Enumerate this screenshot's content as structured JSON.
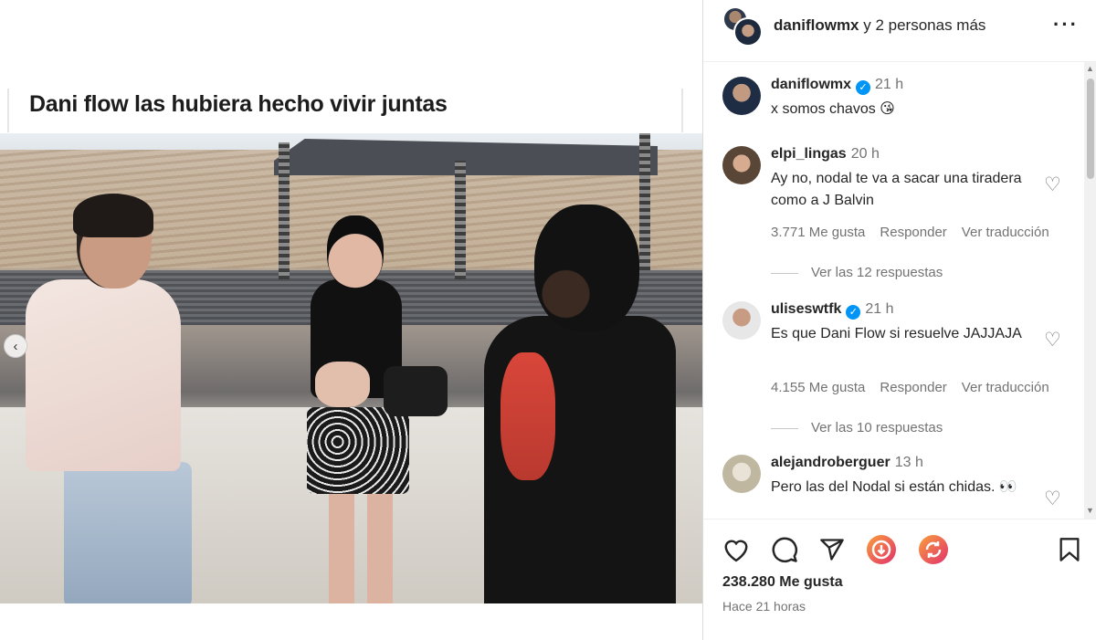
{
  "post": {
    "caption_overlay": "Dani flow las hubiera hecho vivir juntas"
  },
  "header": {
    "owner": "daniflowmx",
    "owner_more": "y 2 personas más"
  },
  "comments": [
    {
      "username": "daniflowmx",
      "verified": true,
      "time": "21 h",
      "text": "x somos chavos 😘"
    },
    {
      "username": "elpi_lingas",
      "verified": false,
      "time": "20 h",
      "text": "Ay no, nodal te va a sacar una tiradera como a J Balvin",
      "likes": "3.771 Me gusta",
      "reply": "Responder",
      "translate": "Ver traducción",
      "view_replies": "Ver las 12 respuestas"
    },
    {
      "username": "uliseswtfk",
      "verified": true,
      "time": "21 h",
      "text": "Es que Dani Flow si resuelve JAJJAJA",
      "likes": "4.155 Me gusta",
      "reply": "Responder",
      "translate": "Ver traducción",
      "view_replies": "Ver las 10 respuestas"
    },
    {
      "username": "alejandroberguer",
      "verified": false,
      "time": "13 h",
      "text": "Pero las del Nodal si están chidas. 👀"
    }
  ],
  "footer": {
    "likes": "238.280 Me gusta",
    "time_ago": "Hace 21 horas"
  },
  "colors": {
    "verified": "#0095f6",
    "muted": "#737373",
    "reel_gradient_start": "#f9a03c",
    "reel_gradient_end": "#e1306c"
  },
  "icons": [
    "chevron-left-icon",
    "more-options-icon",
    "heart-icon",
    "comment-icon",
    "share-icon",
    "download-reel-icon",
    "remix-icon",
    "bookmark-icon",
    "verified-badge-icon"
  ]
}
